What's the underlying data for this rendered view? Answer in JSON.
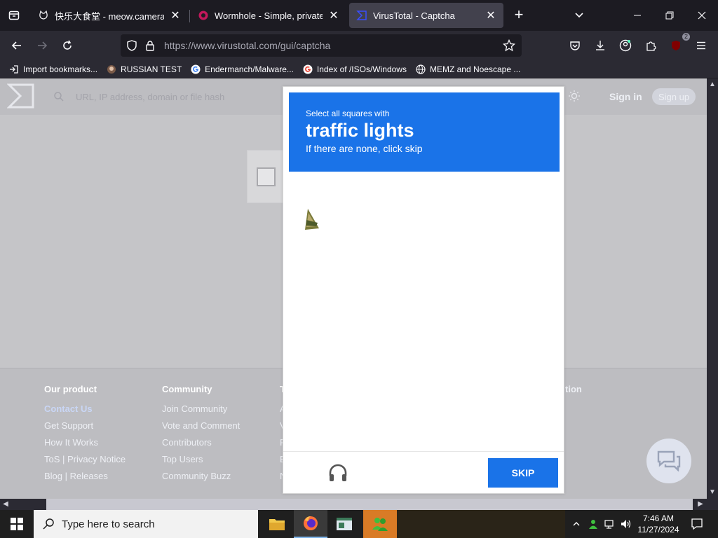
{
  "browser": {
    "tabs": [
      {
        "title": "快乐大食堂 - meow.camera",
        "favicon": "cat-icon",
        "active": false
      },
      {
        "title": "Wormhole - Simple, private file",
        "favicon": "wormhole-icon",
        "active": false
      },
      {
        "title": "VirusTotal - Captcha",
        "favicon": "virustotal-icon",
        "active": true
      }
    ],
    "url_host": "https://www.virustotal.com",
    "url_path": "/gui/captcha",
    "extension_badge": "2",
    "bookmarks": [
      {
        "label": "Import bookmarks...",
        "icon": "import-icon"
      },
      {
        "label": "RUSSIAN TEST",
        "icon": "bookmark-favicon"
      },
      {
        "label": "Endermanch/Malware...",
        "icon": "google-icon"
      },
      {
        "label": "Index of /ISOs/Windows",
        "icon": "google-icon"
      },
      {
        "label": "MEMZ and Noescape ...",
        "icon": "globe-icon"
      }
    ]
  },
  "virustotal": {
    "search_placeholder": "URL, IP address, domain or file hash",
    "sign_in": "Sign in",
    "sign_up": "Sign up",
    "footer": {
      "columns": [
        {
          "heading": "Our product",
          "links": [
            "Contact Us",
            "Get Support",
            "How It Works",
            "ToS | Privacy Notice",
            "Blog | Releases"
          ]
        },
        {
          "heading": "Community",
          "links": [
            "Join Community",
            "Vote and Comment",
            "Contributors",
            "Top Users",
            "Community Buzz"
          ]
        }
      ],
      "partial_heading_3": "T",
      "partial_links_3": [
        "A",
        "V",
        "F",
        "E",
        "N"
      ],
      "partial_heading_right": "tion"
    }
  },
  "captcha": {
    "prompt": "Select all squares with",
    "target": "traffic lights",
    "hint": "If there are none, click skip",
    "skip_label": "SKIP",
    "header_color": "#1a73e8"
  },
  "taskbar": {
    "search_placeholder": "Type here to search",
    "time": "7:46 AM",
    "date": "11/27/2024"
  }
}
